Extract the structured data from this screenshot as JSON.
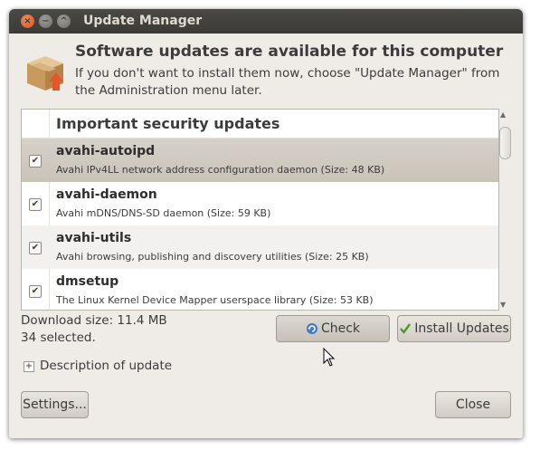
{
  "window": {
    "title": "Update Manager",
    "controls": {
      "close": "×",
      "minimize": "−",
      "maximize": "^"
    }
  },
  "header": {
    "headline": "Software updates are available for this computer",
    "subtext": "If you don't want to install them now, choose \"Update Manager\" from the Administration menu later."
  },
  "list": {
    "section_title": "Important security updates",
    "rows": [
      {
        "name": "avahi-autoipd",
        "description": "Avahi IPv4LL network address configuration daemon (Size: 48 KB)",
        "checked": true,
        "check_glyph": "✔"
      },
      {
        "name": "avahi-daemon",
        "description": "Avahi mDNS/DNS-SD daemon (Size: 59 KB)",
        "checked": true,
        "check_glyph": "✔"
      },
      {
        "name": "avahi-utils",
        "description": "Avahi browsing, publishing and discovery utilities (Size: 25 KB)",
        "checked": true,
        "check_glyph": "✔"
      },
      {
        "name": "dmsetup",
        "description": "The Linux Kernel Device Mapper userspace library (Size: 53 KB)",
        "checked": true,
        "check_glyph": "✔"
      }
    ],
    "scroll_up": "▲",
    "scroll_down": "▼"
  },
  "status": {
    "download_size": "Download size: 11.4 MB",
    "selected": "34 selected."
  },
  "buttons": {
    "check": "Check",
    "install": "Install Updates",
    "settings": "Settings...",
    "close": "Close"
  },
  "expander": {
    "toggle": "+",
    "label": "Description of update"
  },
  "colors": {
    "window_bg": "#efebe7",
    "titlebar": "#3c3b37",
    "selected_row": "#cec8bf",
    "close_button": "#e2622a"
  }
}
